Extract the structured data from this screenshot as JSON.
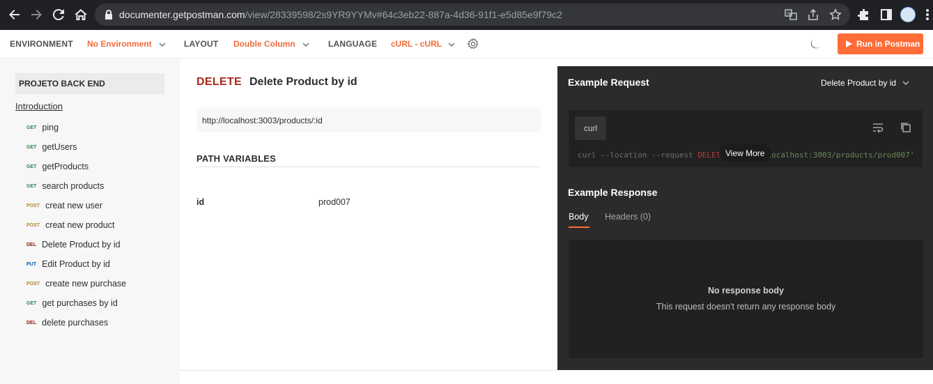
{
  "browser": {
    "url_host": "documenter.getpostman.com",
    "url_path": "/view/28339598/2s9YR9YYMv#64c3eb22-887a-4d36-91f1-e5d85e9f79c2"
  },
  "topbar": {
    "environment_label": "ENVIRONMENT",
    "environment_value": "No Environment",
    "layout_label": "LAYOUT",
    "layout_value": "Double Column",
    "language_label": "LANGUAGE",
    "language_value": "cURL - cURL",
    "run_button": "Run in Postman"
  },
  "sidebar": {
    "collection_name": "PROJETO BACK END",
    "introduction": "Introduction",
    "items": [
      {
        "method": "GET",
        "name": "ping",
        "method_class": "m-get"
      },
      {
        "method": "GET",
        "name": "getUsers",
        "method_class": "m-get"
      },
      {
        "method": "GET",
        "name": "getProducts",
        "method_class": "m-get"
      },
      {
        "method": "GET",
        "name": "search products",
        "method_class": "m-get"
      },
      {
        "method": "POST",
        "name": "creat new user",
        "method_class": "m-post"
      },
      {
        "method": "POST",
        "name": "creat new product",
        "method_class": "m-post"
      },
      {
        "method": "DEL",
        "name": "Delete Product by id",
        "method_class": "m-del"
      },
      {
        "method": "PUT",
        "name": "Edit Product by id",
        "method_class": "m-put"
      },
      {
        "method": "POST",
        "name": "create new purchase",
        "method_class": "m-post"
      },
      {
        "method": "GET",
        "name": "get purchases by id",
        "method_class": "m-get"
      },
      {
        "method": "DEL",
        "name": "delete purchases",
        "method_class": "m-del"
      }
    ]
  },
  "main": {
    "method": "DELETE",
    "title": "Delete Product by id",
    "url": "http://localhost:3003/products/:id",
    "path_variables_title": "PATH VARIABLES",
    "path_variables": [
      {
        "key": "id",
        "value": "prod007"
      }
    ]
  },
  "example": {
    "request_title": "Example Request",
    "request_select": "Delete Product by id",
    "lang_tag": "curl",
    "code_prefix": "curl --location --request ",
    "code_method": "DELETE",
    "code_url": " 'http://localhost:3003/products/prod007'",
    "view_more": "View More",
    "response_title": "Example Response",
    "tab_body": "Body",
    "tab_headers": "Headers (0)",
    "no_body_title": "No response body",
    "no_body_sub": "This request doesn't return any response body"
  },
  "colors": {
    "accent": "#ff6c37",
    "delete_method": "#a8271a",
    "dark_panel": "#2b2b2b"
  }
}
